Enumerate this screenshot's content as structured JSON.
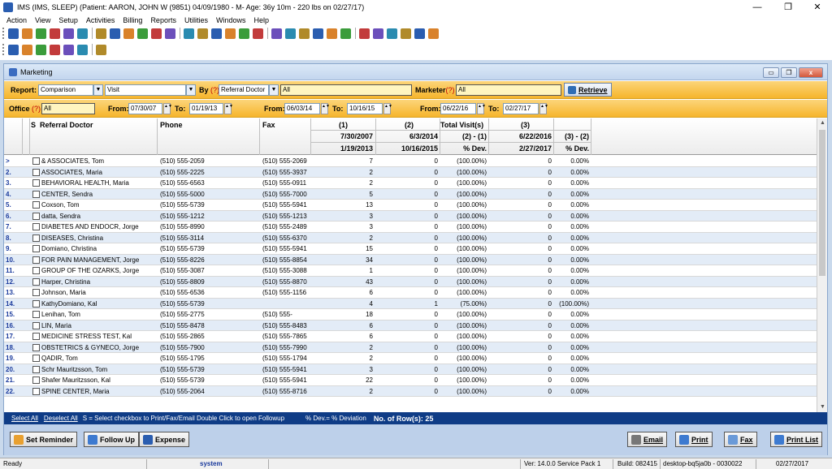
{
  "app": {
    "title": "IMS (IMS, SLEEP)    (Patient: AARON, JOHN W (9851) 04/09/1980 - M- Age: 36y 10m  - 220 lbs on 02/27/17)",
    "controls": {
      "minimize": "—",
      "restore": "❐",
      "close": "✕"
    }
  },
  "menu": [
    "Action",
    "View",
    "Setup",
    "Activities",
    "Billing",
    "Reports",
    "Utilities",
    "Windows",
    "Help"
  ],
  "toolbar1_icons": [
    "user-icon",
    "users-icon",
    "folder-icon",
    "document-icon",
    "clipboard-icon",
    "flask-icon",
    "report-icon",
    "chart-icon",
    "dollar-icon",
    "settings-icon",
    "calendar-icon",
    "mail-icon",
    "lab-icon",
    "notes-icon",
    "book-icon",
    "hospital-icon",
    "task-icon",
    "scan-icon",
    "print-icon",
    "pie-icon",
    "sheet-icon",
    "export-icon",
    "schedule-icon",
    "memo-icon",
    "word-icon",
    "form-icon",
    "list-icon",
    "help-icon",
    "lock-icon",
    "exit-icon"
  ],
  "toolbar2_icons": [
    "first-icon",
    "prev-icon",
    "next-icon",
    "last-icon",
    "refresh-icon",
    "help-icon",
    "close-icon"
  ],
  "window": {
    "title": "Marketing"
  },
  "filters": {
    "report_label": "Report:",
    "report_value": "Comparison",
    "report_type_value": "Visit",
    "by_label": "By",
    "by_q": "(?)",
    "by_value": "Referral Doctor",
    "by_filter_value": "All",
    "marketer_label": "Marketer",
    "marketer_q": "(?)",
    "marketer_value": "All",
    "retrieve_label": "Retrieve",
    "office_label": "Office",
    "office_q": "(?)",
    "office_value": "All",
    "from_label": "From:",
    "to_label": "To:",
    "range1_from": "07/30/07",
    "range1_to": "01/19/13",
    "range2_from": "06/03/14",
    "range2_to": "10/16/15",
    "range3_from": "06/22/16",
    "range3_to": "02/27/17"
  },
  "grid_header": {
    "s": "S",
    "doctor": "Referral Doctor",
    "phone": "Phone",
    "fax": "Fax",
    "g1": "(1)",
    "g2": "(2)",
    "total": "Total Visit(s)",
    "g3": "(3)",
    "c1_from": "7/30/2007",
    "c1_to": "1/19/2013",
    "c2_from": "6/3/2014",
    "c2_to": "10/16/2015",
    "diff21": "(2) - (1)",
    "dev21": "% Dev.",
    "c3_from": "6/22/2016",
    "c3_to": "2/27/2017",
    "diff32": "(3) - (2)",
    "dev32": "% Dev."
  },
  "rows": [
    {
      "num": ">",
      "doctor": "& ASSOCIATES, Tom",
      "phone": "(510) 555-2059",
      "fax": "(510) 555-2069",
      "v1": "7",
      "v2": "0",
      "dev21": "(100.00%)",
      "v3": "0",
      "dev32": "0.00%"
    },
    {
      "num": "2.",
      "doctor": "ASSOCIATES, Maria",
      "phone": "(510) 555-2225",
      "fax": "(510) 555-3937",
      "v1": "2",
      "v2": "0",
      "dev21": "(100.00%)",
      "v3": "0",
      "dev32": "0.00%"
    },
    {
      "num": "3.",
      "doctor": "BEHAVIORAL HEALTH, Maria",
      "phone": "(510) 555-6563",
      "fax": "(510) 555-0911",
      "v1": "2",
      "v2": "0",
      "dev21": "(100.00%)",
      "v3": "0",
      "dev32": "0.00%"
    },
    {
      "num": "4.",
      "doctor": "CENTER, Sendra",
      "phone": "(510) 555-5000",
      "fax": "(510) 555-7000",
      "v1": "5",
      "v2": "0",
      "dev21": "(100.00%)",
      "v3": "0",
      "dev32": "0.00%"
    },
    {
      "num": "5.",
      "doctor": "Coxson, Tom",
      "phone": "(510) 555-5739",
      "fax": "(510) 555-5941",
      "v1": "13",
      "v2": "0",
      "dev21": "(100.00%)",
      "v3": "0",
      "dev32": "0.00%"
    },
    {
      "num": "6.",
      "doctor": "datta, Sendra",
      "phone": "(510) 555-1212",
      "fax": "(510) 555-1213",
      "v1": "3",
      "v2": "0",
      "dev21": "(100.00%)",
      "v3": "0",
      "dev32": "0.00%"
    },
    {
      "num": "7.",
      "doctor": "DIABETES AND ENDOCR, Jorge",
      "phone": "(510) 555-8990",
      "fax": "(510) 555-2489",
      "v1": "3",
      "v2": "0",
      "dev21": "(100.00%)",
      "v3": "0",
      "dev32": "0.00%"
    },
    {
      "num": "8.",
      "doctor": "DISEASES, Christina",
      "phone": "(510) 555-3114",
      "fax": "(510) 555-6370",
      "v1": "2",
      "v2": "0",
      "dev21": "(100.00%)",
      "v3": "0",
      "dev32": "0.00%"
    },
    {
      "num": "9.",
      "doctor": "Domiano, Christina",
      "phone": "(510) 555-5739",
      "fax": "(510) 555-5941",
      "v1": "15",
      "v2": "0",
      "dev21": "(100.00%)",
      "v3": "0",
      "dev32": "0.00%"
    },
    {
      "num": "10.",
      "doctor": "FOR PAIN MANAGEMENT, Jorge",
      "phone": "(510) 555-8226",
      "fax": "(510) 555-8854",
      "v1": "34",
      "v2": "0",
      "dev21": "(100.00%)",
      "v3": "0",
      "dev32": "0.00%"
    },
    {
      "num": "11.",
      "doctor": "GROUP OF THE OZARKS, Jorge",
      "phone": "(510) 555-3087",
      "fax": "(510) 555-3088",
      "v1": "1",
      "v2": "0",
      "dev21": "(100.00%)",
      "v3": "0",
      "dev32": "0.00%"
    },
    {
      "num": "12.",
      "doctor": "Harper, Christina",
      "phone": "(510) 555-8809",
      "fax": "(510) 555-8870",
      "v1": "43",
      "v2": "0",
      "dev21": "(100.00%)",
      "v3": "0",
      "dev32": "0.00%"
    },
    {
      "num": "13.",
      "doctor": "Johnson, Maria",
      "phone": "(510) 555-6536",
      "fax": "(510) 555-1156",
      "v1": "6",
      "v2": "0",
      "dev21": "(100.00%)",
      "v3": "0",
      "dev32": "0.00%"
    },
    {
      "num": "14.",
      "doctor": "KathyDomiano, Kal",
      "phone": "(510) 555-5739",
      "fax": "",
      "v1": "4",
      "v2": "1",
      "dev21": "(75.00%)",
      "v3": "0",
      "dev32": "(100.00%)"
    },
    {
      "num": "15.",
      "doctor": "Lenihan, Tom",
      "phone": "(510) 555-2775",
      "fax": "(510) 555-",
      "v1": "18",
      "v2": "0",
      "dev21": "(100.00%)",
      "v3": "0",
      "dev32": "0.00%"
    },
    {
      "num": "16.",
      "doctor": "LIN, Maria",
      "phone": "(510) 555-8478",
      "fax": "(510) 555-8483",
      "v1": "6",
      "v2": "0",
      "dev21": "(100.00%)",
      "v3": "0",
      "dev32": "0.00%"
    },
    {
      "num": "17.",
      "doctor": "MEDICINE STRESS TEST, Kal",
      "phone": "(510) 555-2865",
      "fax": "(510) 555-7865",
      "v1": "6",
      "v2": "0",
      "dev21": "(100.00%)",
      "v3": "0",
      "dev32": "0.00%"
    },
    {
      "num": "18.",
      "doctor": "OBSTETRICS & GYNECO, Jorge",
      "phone": "(510) 555-7900",
      "fax": "(510) 555-7990",
      "v1": "2",
      "v2": "0",
      "dev21": "(100.00%)",
      "v3": "0",
      "dev32": "0.00%"
    },
    {
      "num": "19.",
      "doctor": "QADIR, Tom",
      "phone": "(510) 555-1795",
      "fax": "(510) 555-1794",
      "v1": "2",
      "v2": "0",
      "dev21": "(100.00%)",
      "v3": "0",
      "dev32": "0.00%"
    },
    {
      "num": "20.",
      "doctor": "Schr Mauritzsson, Tom",
      "phone": "(510) 555-5739",
      "fax": "(510) 555-5941",
      "v1": "3",
      "v2": "0",
      "dev21": "(100.00%)",
      "v3": "0",
      "dev32": "0.00%"
    },
    {
      "num": "21.",
      "doctor": "Shafer Mauritzsson, Kal",
      "phone": "(510) 555-5739",
      "fax": "(510) 555-5941",
      "v1": "22",
      "v2": "0",
      "dev21": "(100.00%)",
      "v3": "0",
      "dev32": "0.00%"
    },
    {
      "num": "22.",
      "doctor": "SPINE CENTER, Maria",
      "phone": "(510) 555-2064",
      "fax": "(510) 555-8716",
      "v1": "2",
      "v2": "0",
      "dev21": "(100.00%)",
      "v3": "0",
      "dev32": "0.00%"
    }
  ],
  "legend": {
    "select_all": "Select All",
    "deselect_all": "Deselect All",
    "help": "S = Select checkbox to Print/Fax/Email  Double Click to open Followup",
    "dev_help": "% Dev.= % Deviation",
    "rows_count": "No. of Row(s): 25"
  },
  "buttons": {
    "set_reminder": "Set Reminder",
    "follow_up": "Follow Up",
    "expense": "Expense",
    "email": "Email",
    "print": "Print",
    "fax": "Fax",
    "print_list": "Print List"
  },
  "status": {
    "ready": "Ready",
    "user": "system",
    "version": "Ver: 14.0.0 Service Pack 1",
    "build": "Build: 082415",
    "machine": "desktop-bq5ja0b - 0030022",
    "date": "02/27/2017"
  }
}
